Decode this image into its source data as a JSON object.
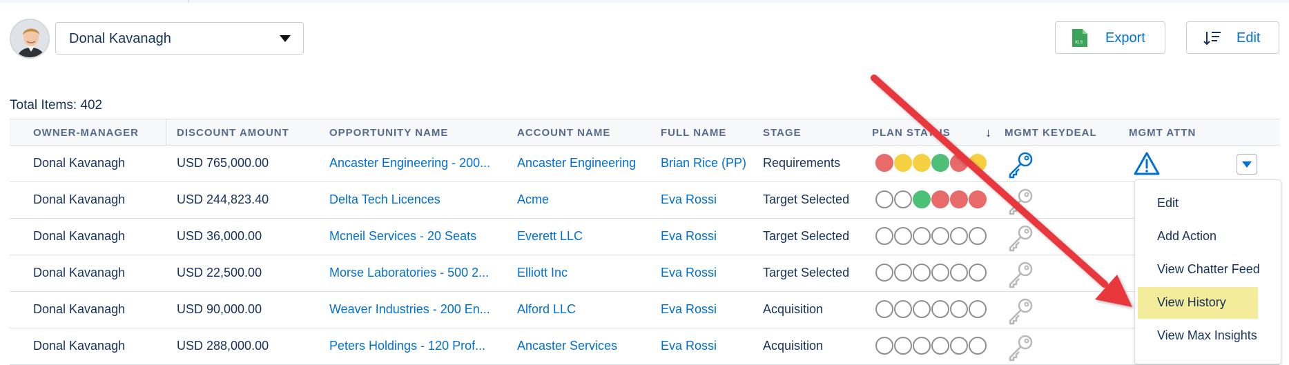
{
  "owner_selector": {
    "value": "Donal Kavanagh"
  },
  "toolbar": {
    "export_label": "Export",
    "export_icon": "xls-file-icon",
    "edit_label": "Edit",
    "edit_icon": "sort-lines-icon",
    "export_icon_text": "XLS"
  },
  "total_items": "Total Items: 402",
  "table": {
    "columns": [
      "OWNER-MANAGER",
      "DISCOUNT AMOUNT",
      "OPPORTUNITY NAME",
      "ACCOUNT NAME",
      "FULL NAME",
      "STAGE",
      "PLAN STATUS",
      "MGMT KEYDEAL",
      "MGMT ATTN"
    ],
    "sort_indicator": "↓",
    "rows": [
      {
        "owner": "Donal Kavanagh",
        "discount": "USD 765,000.00",
        "opportunity": "Ancaster Engineering - 200...",
        "account": "Ancaster Engineering",
        "full_name": "Brian Rice (PP)",
        "stage": "Requirements",
        "plan_status": [
          "red",
          "yellow",
          "yellow",
          "green",
          "red",
          "yellow"
        ],
        "keydeal": true,
        "attn": true,
        "menu_open": true
      },
      {
        "owner": "Donal Kavanagh",
        "discount": "USD 244,823.40",
        "opportunity": "Delta Tech Licences",
        "account": "Acme",
        "full_name": "Eva Rossi",
        "stage": "Target Selected",
        "plan_status": [
          "empty",
          "empty",
          "green",
          "red",
          "red",
          "red"
        ],
        "keydeal": false,
        "attn": false
      },
      {
        "owner": "Donal Kavanagh",
        "discount": "USD 36,000.00",
        "opportunity": "Mcneil Services - 20 Seats",
        "account": "Everett LLC",
        "full_name": "Eva Rossi",
        "stage": "Target Selected",
        "plan_status": [
          "empty",
          "empty",
          "empty",
          "empty",
          "empty",
          "empty"
        ],
        "keydeal": false,
        "attn": false
      },
      {
        "owner": "Donal Kavanagh",
        "discount": "USD 22,500.00",
        "opportunity": "Morse Laboratories - 500 2...",
        "account": "Elliott Inc",
        "full_name": "Eva Rossi",
        "stage": "Target Selected",
        "plan_status": [
          "empty",
          "empty",
          "empty",
          "empty",
          "empty",
          "empty"
        ],
        "keydeal": false,
        "attn": false
      },
      {
        "owner": "Donal Kavanagh",
        "discount": "USD 90,000.00",
        "opportunity": "Weaver Industries - 200 En...",
        "account": "Alford LLC",
        "full_name": "Eva Rossi",
        "stage": "Acquisition",
        "plan_status": [
          "empty",
          "empty",
          "empty",
          "empty",
          "empty",
          "empty"
        ],
        "keydeal": false,
        "attn": false
      },
      {
        "owner": "Donal Kavanagh",
        "discount": "USD 288,000.00",
        "opportunity": "Peters Holdings - 120 Prof...",
        "account": "Ancaster Services",
        "full_name": "Eva Rossi",
        "stage": "Acquisition",
        "plan_status": [
          "empty",
          "empty",
          "empty",
          "empty",
          "empty",
          "empty"
        ],
        "keydeal": false,
        "attn": false
      }
    ]
  },
  "row_menu": {
    "items": [
      "Edit",
      "Add Action",
      "View Chatter Feed",
      "View History",
      "View Max Insights"
    ],
    "highlighted": "View History"
  },
  "colors": {
    "accent": "#0070d2",
    "red": "#e96a6a",
    "yellow": "#f5d142",
    "green": "#4bc076",
    "highlight": "#f2ec9b",
    "annotation_arrow": "#e8373e"
  }
}
